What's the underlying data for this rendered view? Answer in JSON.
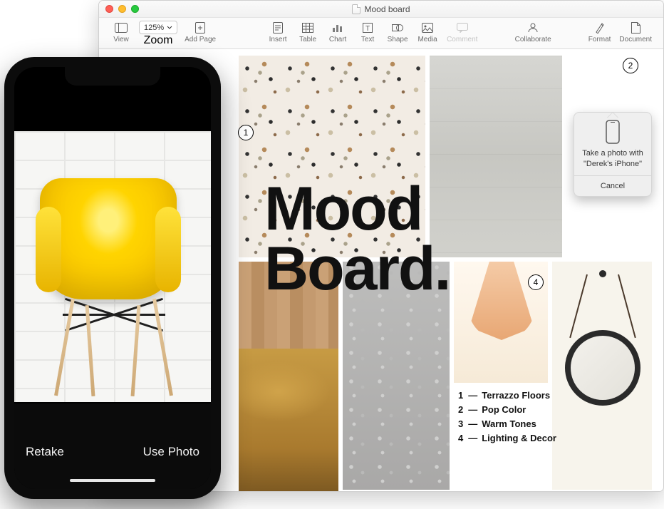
{
  "window": {
    "title": "Mood board"
  },
  "toolbar": {
    "view": "View",
    "zoom_label": "Zoom",
    "zoom_value": "125%",
    "add_page": "Add Page",
    "insert": "Insert",
    "table": "Table",
    "chart": "Chart",
    "text": "Text",
    "shape": "Shape",
    "media": "Media",
    "comment": "Comment",
    "collaborate": "Collaborate",
    "format": "Format",
    "document": "Document"
  },
  "board": {
    "title_line1": "Mood",
    "title_line2": "Board.",
    "list": [
      {
        "num": "1",
        "label": "Terrazzo Floors"
      },
      {
        "num": "2",
        "label": "Pop Color"
      },
      {
        "num": "3",
        "label": "Warm Tones"
      },
      {
        "num": "4",
        "label": "Lighting & Decor"
      }
    ],
    "callouts": {
      "c1": "1",
      "c2": "2",
      "c4": "4"
    }
  },
  "popover": {
    "message": "Take a photo with \"Derek's iPhone\"",
    "cancel": "Cancel"
  },
  "iphone": {
    "retake": "Retake",
    "use_photo": "Use Photo"
  }
}
